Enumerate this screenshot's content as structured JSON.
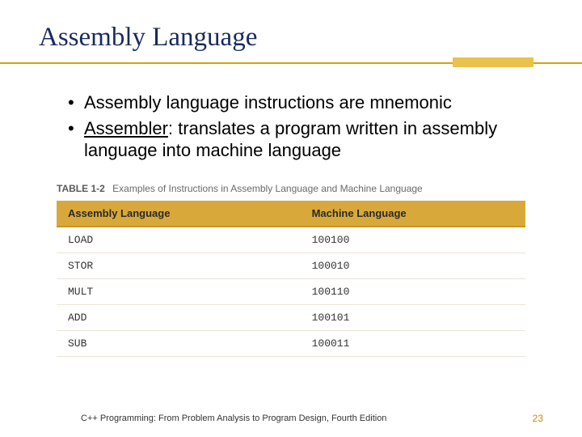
{
  "title": "Assembly Language",
  "bullets": [
    {
      "text_before": "Assembly language instructions are mnemonic",
      "underlined": "",
      "text_after": ""
    },
    {
      "text_before": "",
      "underlined": "Assembler",
      "text_after": ": translates a program written in assembly language into machine language"
    }
  ],
  "table": {
    "label_prefix": "TABLE 1-2",
    "caption": "Examples of Instructions in Assembly Language and Machine Language",
    "headers": [
      "Assembly Language",
      "Machine Language"
    ],
    "rows": [
      [
        "LOAD",
        "100100"
      ],
      [
        "STOR",
        "100010"
      ],
      [
        "MULT",
        "100110"
      ],
      [
        "ADD",
        "100101"
      ],
      [
        "SUB",
        "100011"
      ]
    ]
  },
  "footer": {
    "text": "C++ Programming: From Problem Analysis to Program Design, Fourth Edition",
    "page": "23"
  },
  "chart_data": {
    "type": "table",
    "title": "Examples of Instructions in Assembly Language and Machine Language",
    "columns": [
      "Assembly Language",
      "Machine Language"
    ],
    "rows": [
      [
        "LOAD",
        "100100"
      ],
      [
        "STOR",
        "100010"
      ],
      [
        "MULT",
        "100110"
      ],
      [
        "ADD",
        "100101"
      ],
      [
        "SUB",
        "100011"
      ]
    ]
  }
}
